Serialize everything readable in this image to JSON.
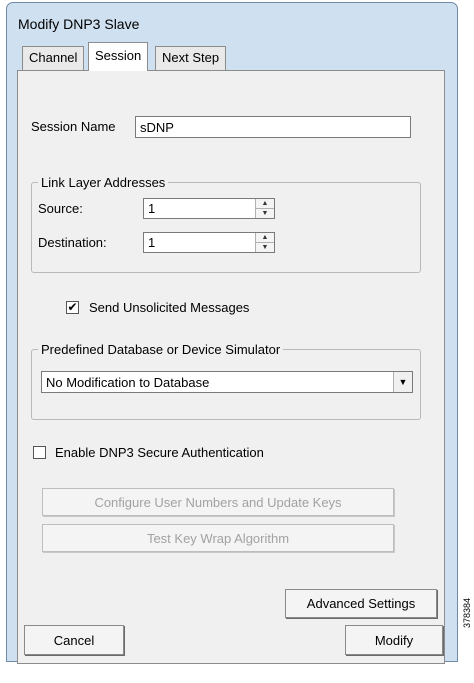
{
  "window": {
    "title": "Modify DNP3 Slave"
  },
  "tabs": [
    {
      "label": "Channel"
    },
    {
      "label": "Session"
    },
    {
      "label": "Next Step"
    }
  ],
  "session_name": {
    "label": "Session Name",
    "value": "sDNP"
  },
  "link_layer": {
    "title": "Link Layer Addresses",
    "source_label": "Source:",
    "source_value": "1",
    "destination_label": "Destination:",
    "destination_value": "1"
  },
  "send_unsolicited": {
    "label": "Send Unsolicited Messages",
    "checked": true,
    "mark": "✔"
  },
  "database_group": {
    "title": "Predefined Database or Device Simulator",
    "selected": "No Modification to Database"
  },
  "secure_auth": {
    "label": "Enable DNP3 Secure Authentication",
    "checked": false
  },
  "buttons": {
    "configure_keys": "Configure User Numbers and Update Keys",
    "test_key_wrap": "Test Key Wrap Algorithm",
    "advanced": "Advanced Settings",
    "cancel": "Cancel",
    "modify": "Modify"
  },
  "figure_id": "378384"
}
